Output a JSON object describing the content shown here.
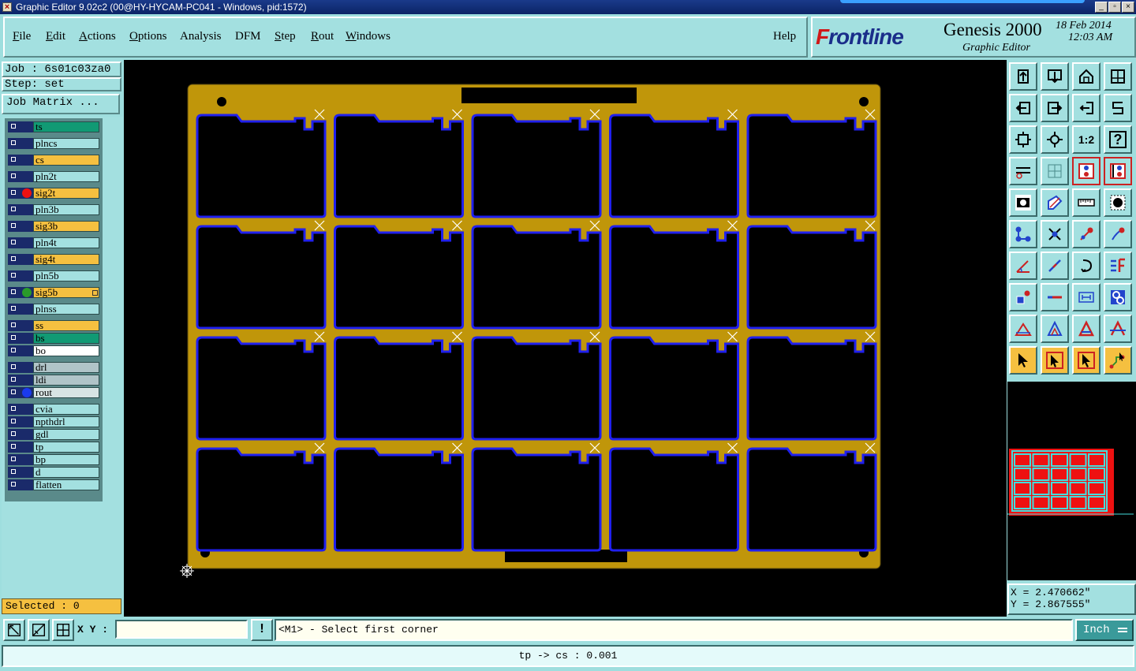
{
  "window": {
    "title": "Graphic Editor 9.02c2 (00@HY-HYCAM-PC041 - Windows, pid:1572)",
    "min_glyph": "_",
    "max_glyph": "▫",
    "close_glyph": "×"
  },
  "menu": [
    {
      "u": "F",
      "rest": "ile"
    },
    {
      "u": "E",
      "rest": "dit"
    },
    {
      "u": "A",
      "rest": "ctions"
    },
    {
      "u": "O",
      "rest": "ptions"
    },
    {
      "u": "",
      "rest": "Analysis"
    },
    {
      "u": "",
      "rest": "DFM"
    },
    {
      "u": "S",
      "rest": "tep"
    },
    {
      "u": "R",
      "rest": "out"
    },
    {
      "u": "W",
      "rest": "indows"
    }
  ],
  "help_label": "Help",
  "brand": {
    "logo_first": "F",
    "logo_rest": "rontline",
    "product": "Genesis 2000",
    "subtitle": "Graphic Editor",
    "date": "18 Feb 2014",
    "time": "12:03 AM",
    "logo_color": "#1a2e8a",
    "logo_accent": "#d01818"
  },
  "job": {
    "job_label": "Job : 6s01c03za0",
    "step_label": "Step: set",
    "matrix_button": "Job Matrix ..."
  },
  "layers": [
    {
      "name": "ts",
      "color": "#119a74"
    },
    {
      "name": "plncs",
      "color": "#a3e0e0"
    },
    {
      "name": "cs",
      "color": "#f5c040"
    },
    {
      "name": "pln2t",
      "color": "#a3e0e0"
    },
    {
      "name": "sig2t",
      "color": "#f5c040",
      "dot": "#ee1111"
    },
    {
      "name": "pln3b",
      "color": "#a3e0e0"
    },
    {
      "name": "sig3b",
      "color": "#f5c040"
    },
    {
      "name": "pln4t",
      "color": "#a3e0e0"
    },
    {
      "name": "sig4t",
      "color": "#f5c040"
    },
    {
      "name": "pln5b",
      "color": "#a3e0e0"
    },
    {
      "name": "sig5b",
      "color": "#f5c040",
      "dot": "#2a9a2a",
      "active": true
    },
    {
      "name": "plnss",
      "color": "#a3e0e0"
    },
    {
      "name": "ss",
      "color": "#f5c040"
    },
    {
      "name": "bs",
      "color": "#119a74"
    },
    {
      "name": "bo",
      "color": "#ffffff"
    },
    {
      "name": "drl",
      "color": "#b0c4c8"
    },
    {
      "name": "ldi",
      "color": "#b0c4c8"
    },
    {
      "name": "rout",
      "color": "#d8e4e4",
      "dot": "#1a3aee"
    },
    {
      "name": "cvia",
      "color": "#a3e0e0"
    },
    {
      "name": "npthdrl",
      "color": "#a3e0e0"
    },
    {
      "name": "gdl",
      "color": "#a3e0e0"
    },
    {
      "name": "tp",
      "color": "#a3e0e0"
    },
    {
      "name": "bp",
      "color": "#a3e0e0"
    },
    {
      "name": "d",
      "color": "#a3e0e0"
    },
    {
      "name": "flatten",
      "color": "#a3e0e0"
    }
  ],
  "selected_label": "Selected : 0",
  "board": {
    "rows": 4,
    "cols": 5,
    "panel_color": "#c0960a",
    "outline_color": "#2020ee"
  },
  "tools": [
    "move-up-icon",
    "move-down-icon",
    "home-icon",
    "window-split-icon",
    "move-left-icon",
    "move-right-icon",
    "undo-move-icon",
    "swap-icon",
    "zoom-fit-icon",
    "zoom-center-icon",
    "zoom-1-2-icon",
    "help-icon",
    "tools-icon",
    "grid-icon",
    "layers-compare-icon",
    "layers-list-icon",
    "snapshot-icon",
    "draw-icon",
    "ruler-icon",
    "pad-icon",
    "connect-icon",
    "cross-icon",
    "line-dot-icon",
    "arc-dot-icon",
    "angle-icon",
    "line-icon",
    "rotate-icon",
    "flip-icon",
    "pad-select-icon",
    "minus-icon",
    "measure-icon",
    "pad-group-icon",
    "triangle-icon",
    "triangle-alt-icon",
    "triangle-red-icon",
    "triangle-line-icon",
    "select-pointer-icon",
    "select-box-icon",
    "select-touch-icon",
    "select-net-icon"
  ],
  "tool_labels": {
    "zoom-1-2-icon": "1:2",
    "help-icon": "?"
  },
  "coords": {
    "x": "X = 2.470662\"",
    "y": "Y = 2.867555\""
  },
  "bottom": {
    "xy_label": "X Y :",
    "xy_value": "",
    "excl": "!",
    "message": "<M1> - Select first corner",
    "units": "Inch"
  },
  "status": "tp -> cs : 0.001"
}
